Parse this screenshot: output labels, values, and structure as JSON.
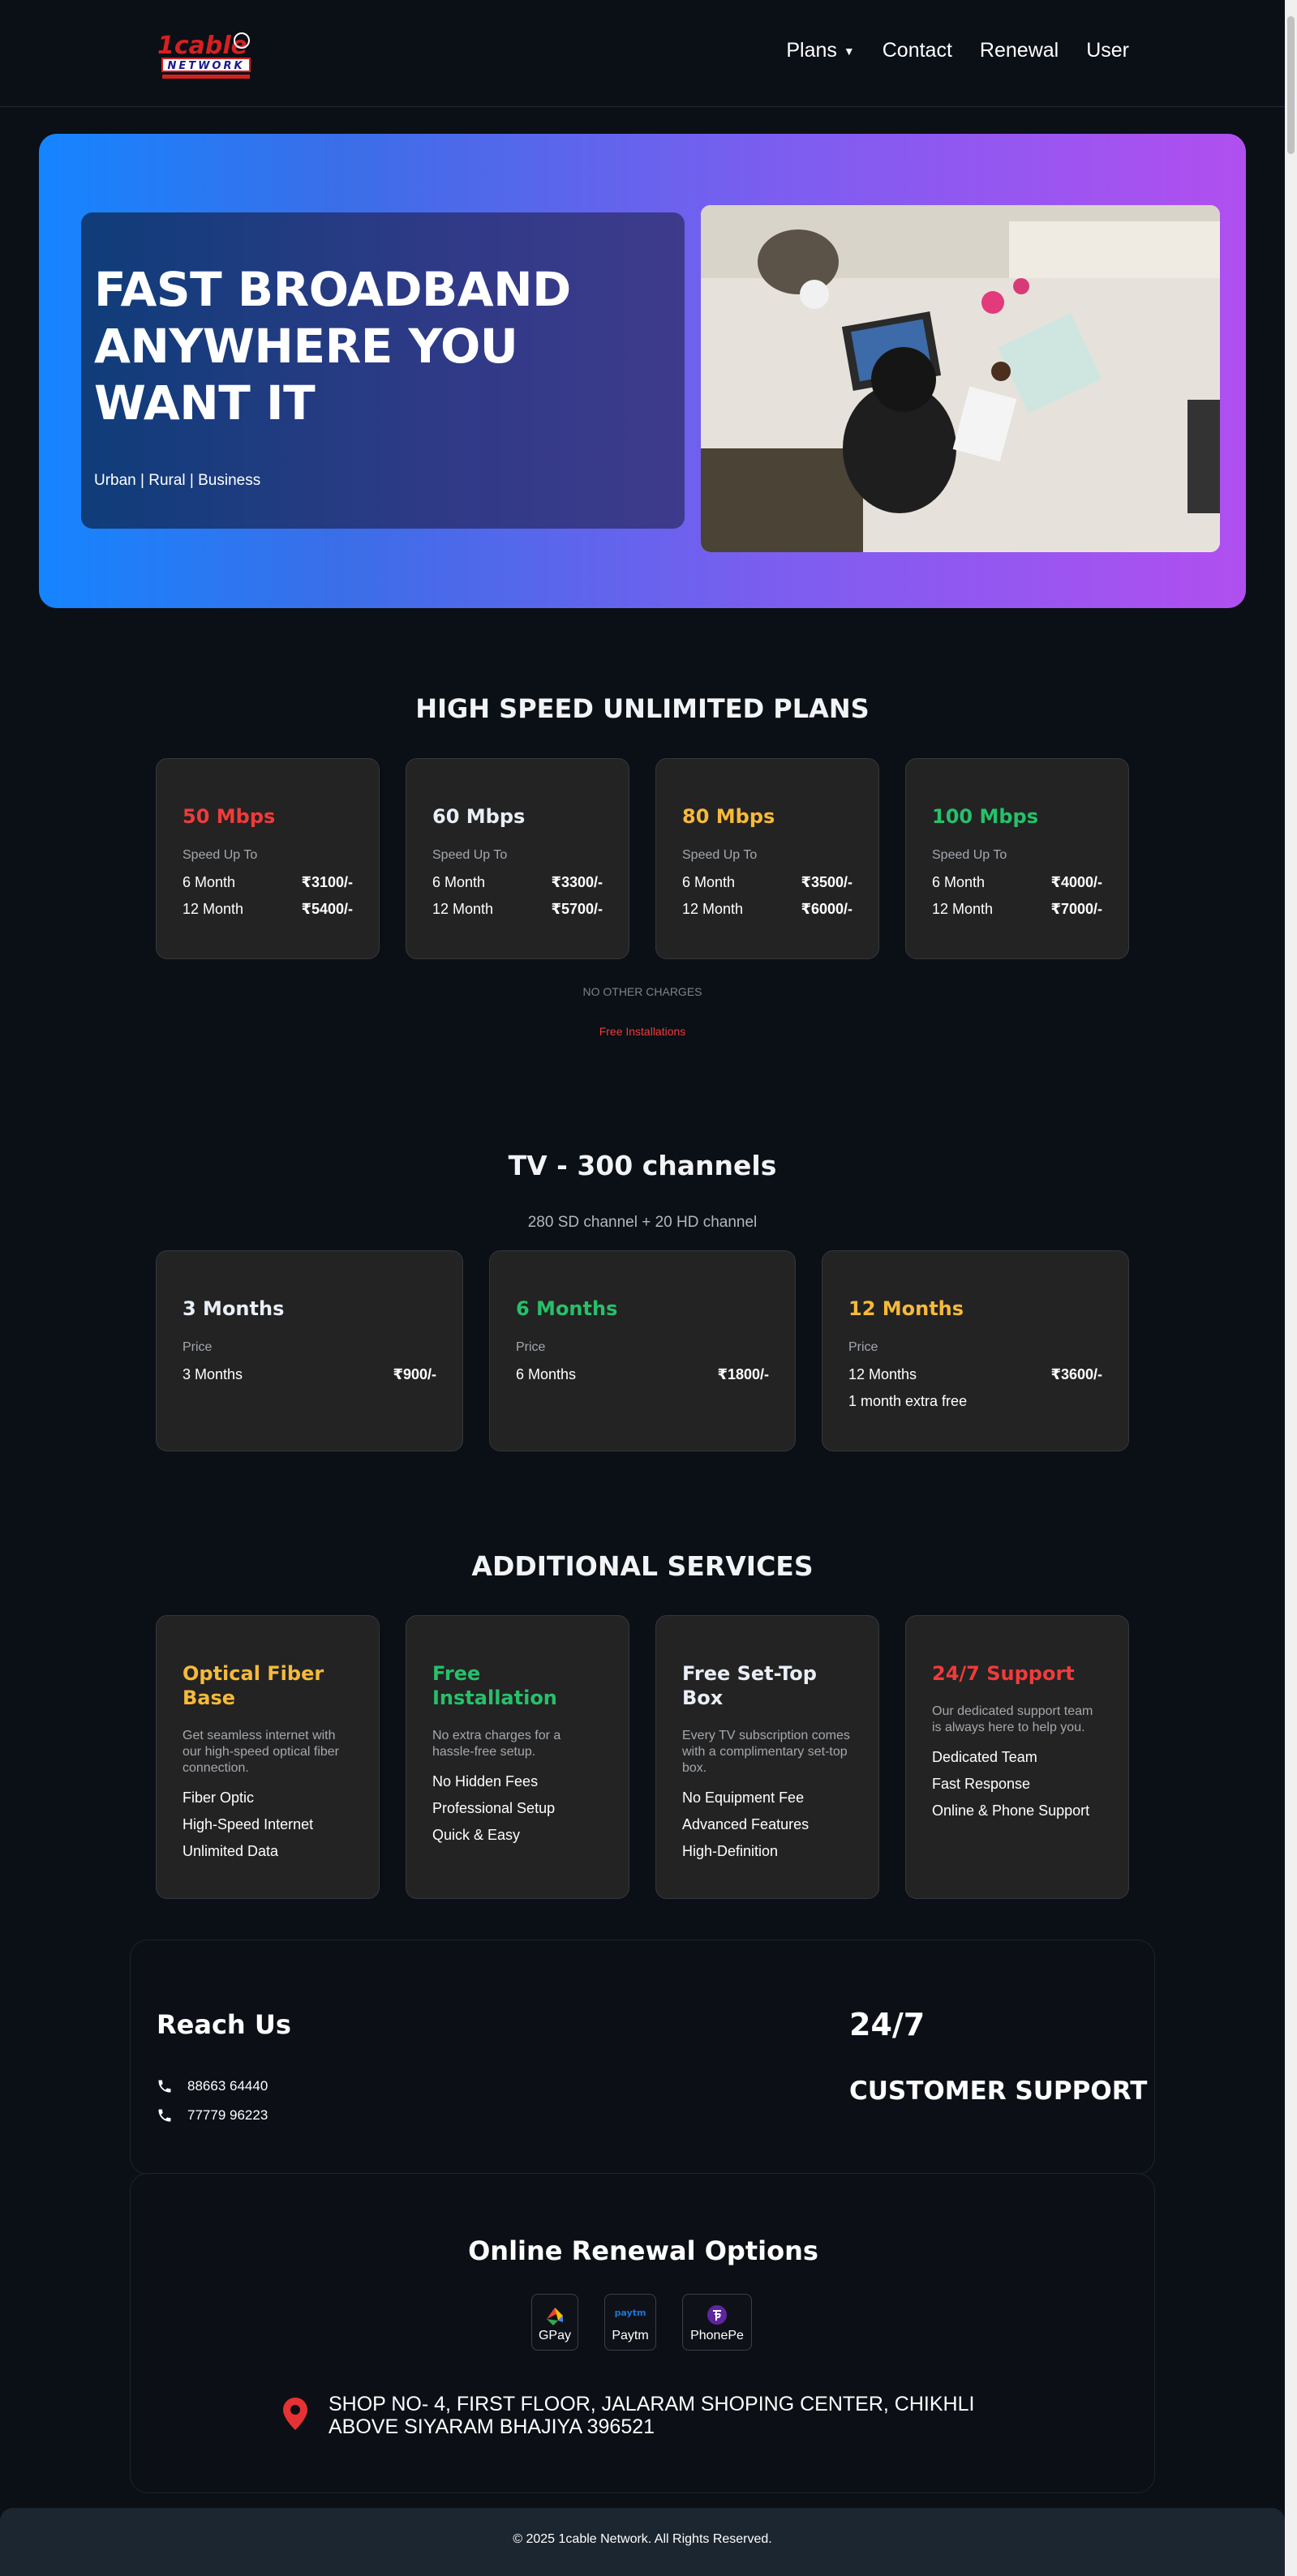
{
  "nav": {
    "logo_text_top": "1cable",
    "logo_text_bottom": "NETWORK",
    "links": {
      "plans": "Plans",
      "contact": "Contact",
      "renewal": "Renewal",
      "user": "User"
    },
    "caret": "▼"
  },
  "hero": {
    "title": "FAST BROADBAND ANYWHERE YOU WANT IT",
    "subtitle": "Urban | Rural | Business"
  },
  "plans": {
    "heading": "HIGH SPEED UNLIMITED PLANS",
    "items": [
      {
        "speed": "50 Mbps",
        "label": "Speed Up To",
        "r1": "6 Month",
        "p1": "₹3100/-",
        "r2": "12 Month",
        "p2": "₹5400/-",
        "color": "#f03b3b"
      },
      {
        "speed": "60 Mbps",
        "label": "Speed Up To",
        "r1": "6 Month",
        "p1": "₹3300/-",
        "r2": "12 Month",
        "p2": "₹5700/-",
        "color": "#e9eef7"
      },
      {
        "speed": "80 Mbps",
        "label": "Speed Up To",
        "r1": "6 Month",
        "p1": "₹3500/-",
        "r2": "12 Month",
        "p2": "₹6000/-",
        "color": "#f6b93b"
      },
      {
        "speed": "100 Mbps",
        "label": "Speed Up To",
        "r1": "6 Month",
        "p1": "₹4000/-",
        "r2": "12 Month",
        "p2": "₹7000/-",
        "color": "#27c06a"
      }
    ],
    "note": "NO OTHER CHARGES",
    "free_install": "Free Installations"
  },
  "tv": {
    "heading": "TV - 300 channels",
    "subheading": "280 SD channel + 20 HD channel",
    "items": [
      {
        "title": "3 Months",
        "label": "Price",
        "r1": "3 Months",
        "p1": "₹900/-",
        "extra": ""
      },
      {
        "title": "6 Months",
        "label": "Price",
        "r1": "6 Months",
        "p1": "₹1800/-",
        "extra": ""
      },
      {
        "title": "12 Months",
        "label": "Price",
        "r1": "12 Months",
        "p1": "₹3600/-",
        "extra": "1 month extra free"
      }
    ]
  },
  "services": {
    "heading": "ADDITIONAL SERVICES",
    "items": [
      {
        "title": "Optical Fiber Base",
        "desc": "Get seamless internet with our high-speed optical fiber connection.",
        "list": [
          "Fiber Optic",
          "High-Speed Internet",
          "Unlimited Data"
        ]
      },
      {
        "title": "Free Installation",
        "desc": "No extra charges for a hassle-free setup.",
        "list": [
          "No Hidden Fees",
          "Professional Setup",
          "Quick & Easy"
        ]
      },
      {
        "title": "Free Set-Top Box",
        "desc": "Every TV subscription comes with a complimentary set-top box.",
        "list": [
          "No Equipment Fee",
          "Advanced Features",
          "High-Definition"
        ]
      },
      {
        "title": "24/7 Support",
        "desc": "Our dedicated support team is always here to help you.",
        "list": [
          "Dedicated Team",
          "Fast Response",
          "Online & Phone Support"
        ]
      }
    ]
  },
  "contact": {
    "heading": "Reach Us",
    "phones": [
      "88663 64440",
      "77779 96223"
    ],
    "support_hours": "24/7",
    "support_label": "CUSTOMER SUPPORT"
  },
  "renewal": {
    "heading": "Online Renewal Options",
    "options": [
      "GPay",
      "Paytm",
      "PhonePe"
    ],
    "paytm_mark": "paytm",
    "address_line1": "SHOP NO- 4, FIRST FLOOR, JALARAM SHOPING CENTER, CHIKHLI",
    "address_line2": "ABOVE SIYARAM BHAJIYA 396521"
  },
  "footer": {
    "copyright": "© 2025 1cable Network. All Rights Reserved."
  }
}
